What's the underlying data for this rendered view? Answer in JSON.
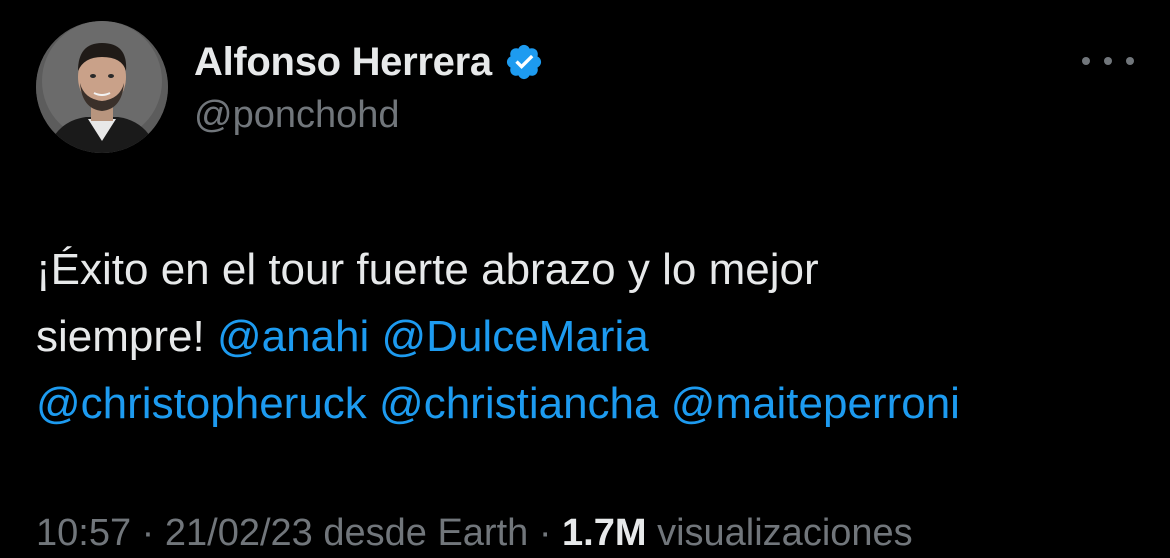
{
  "author": {
    "display_name": "Alfonso Herrera",
    "handle": "@ponchohd",
    "verified": true,
    "verified_color": "#1d9bf0"
  },
  "tweet": {
    "text_line1": "¡Éxito en el tour fuerte abrazo y lo mejor",
    "text_line2_prefix": "siempre! ",
    "mentions": [
      "@anahi",
      "@DulceMaria",
      "@christopheruck",
      "@christiancha",
      "@maiteperroni"
    ]
  },
  "meta": {
    "time": "10:57",
    "separator": " · ",
    "date": "21/02/23",
    "via": " desde Earth · ",
    "views": "1.7M",
    "views_label": " visualizaciones"
  },
  "colors": {
    "background": "#000000",
    "text": "#e7e9ea",
    "secondary": "#71767b",
    "link": "#1d9bf0"
  },
  "icons": {
    "verified": "verified-badge-icon",
    "more": "more-options-icon"
  }
}
